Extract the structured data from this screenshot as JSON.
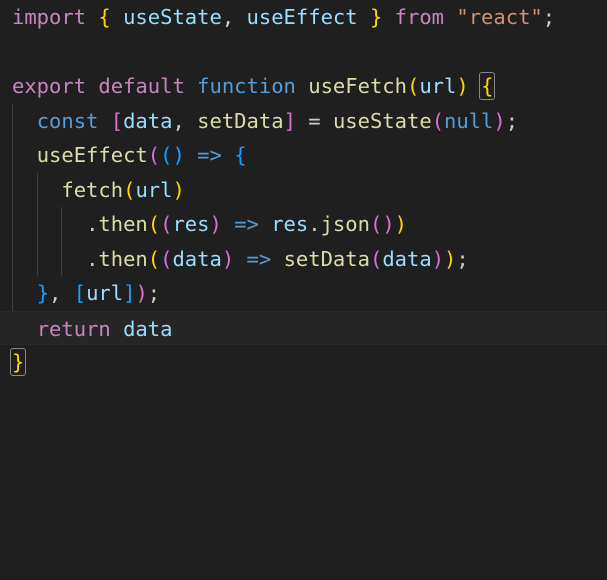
{
  "editor": {
    "name": "code-editor",
    "language": "javascript",
    "theme": "dark-plus",
    "background_color": "#1f1f1f",
    "current_line_color": "#262626",
    "indent_guide_color": "#404040",
    "bracket_match_outline_color": "#888888",
    "font_size_px": 20.5,
    "line_height_px": 34.5,
    "gutter_visible": false,
    "current_line_number": 10,
    "total_lines": 12
  },
  "colors": {
    "keyword": "#c586c0",
    "storage": "#569cd6",
    "variable": "#9cdcfe",
    "function": "#dcdcaa",
    "string": "#ce9178",
    "operator": "#569cd6",
    "punctuation": "#cccccc",
    "bracket_level_1": "#ffd700",
    "bracket_level_2": "#da70d6",
    "bracket_level_3": "#179fff",
    "plain_text": "#d4d4d4"
  },
  "code": {
    "plain_text": "import { useState, useEffect } from \"react\";\n\nexport default function useFetch(url) {\n  const [data, setData] = useState(null);\n  useEffect(() => {\n    fetch(url)\n      .then((res) => res.json())\n      .then((data) => setData(data));\n  }, [url]);\n  return data\n}",
    "lines": [
      {
        "number": 1,
        "indent": 0,
        "current": false,
        "tokens": [
          {
            "text": "import",
            "type": "keyword"
          },
          {
            "text": " ",
            "type": "plain"
          },
          {
            "text": "{",
            "type": "bracket1"
          },
          {
            "text": " ",
            "type": "plain"
          },
          {
            "text": "useState",
            "type": "variable"
          },
          {
            "text": ",",
            "type": "punct"
          },
          {
            "text": " ",
            "type": "plain"
          },
          {
            "text": "useEffect",
            "type": "variable"
          },
          {
            "text": " ",
            "type": "plain"
          },
          {
            "text": "}",
            "type": "bracket1"
          },
          {
            "text": " ",
            "type": "plain"
          },
          {
            "text": "from",
            "type": "keyword"
          },
          {
            "text": " ",
            "type": "plain"
          },
          {
            "text": "\"react\"",
            "type": "string"
          },
          {
            "text": ";",
            "type": "punct"
          }
        ]
      },
      {
        "number": 2,
        "indent": 0,
        "current": false,
        "tokens": []
      },
      {
        "number": 3,
        "indent": 0,
        "current": false,
        "tokens": [
          {
            "text": "export",
            "type": "keyword"
          },
          {
            "text": " ",
            "type": "plain"
          },
          {
            "text": "default",
            "type": "keyword"
          },
          {
            "text": " ",
            "type": "plain"
          },
          {
            "text": "function",
            "type": "storage"
          },
          {
            "text": " ",
            "type": "plain"
          },
          {
            "text": "useFetch",
            "type": "function"
          },
          {
            "text": "(",
            "type": "bracket1"
          },
          {
            "text": "url",
            "type": "variable"
          },
          {
            "text": ")",
            "type": "bracket1"
          },
          {
            "text": " ",
            "type": "plain"
          },
          {
            "text": "{",
            "type": "bracket1",
            "match": true
          }
        ]
      },
      {
        "number": 4,
        "indent": 1,
        "current": false,
        "tokens": [
          {
            "text": "  ",
            "type": "plain"
          },
          {
            "text": "const",
            "type": "storage"
          },
          {
            "text": " ",
            "type": "plain"
          },
          {
            "text": "[",
            "type": "bracket2"
          },
          {
            "text": "data",
            "type": "variable"
          },
          {
            "text": ",",
            "type": "punct"
          },
          {
            "text": " ",
            "type": "plain"
          },
          {
            "text": "setData",
            "type": "function"
          },
          {
            "text": "]",
            "type": "bracket2"
          },
          {
            "text": " ",
            "type": "plain"
          },
          {
            "text": "=",
            "type": "punct"
          },
          {
            "text": " ",
            "type": "plain"
          },
          {
            "text": "useState",
            "type": "function"
          },
          {
            "text": "(",
            "type": "bracket2"
          },
          {
            "text": "null",
            "type": "storage"
          },
          {
            "text": ")",
            "type": "bracket2"
          },
          {
            "text": ";",
            "type": "punct"
          }
        ]
      },
      {
        "number": 5,
        "indent": 1,
        "current": false,
        "tokens": [
          {
            "text": "  ",
            "type": "plain"
          },
          {
            "text": "useEffect",
            "type": "function"
          },
          {
            "text": "(",
            "type": "bracket2"
          },
          {
            "text": "(",
            "type": "bracket3"
          },
          {
            "text": ")",
            "type": "bracket3"
          },
          {
            "text": " ",
            "type": "plain"
          },
          {
            "text": "=>",
            "type": "operator"
          },
          {
            "text": " ",
            "type": "plain"
          },
          {
            "text": "{",
            "type": "bracket3"
          }
        ]
      },
      {
        "number": 6,
        "indent": 2,
        "current": false,
        "tokens": [
          {
            "text": "    ",
            "type": "plain"
          },
          {
            "text": "fetch",
            "type": "function"
          },
          {
            "text": "(",
            "type": "bracket1"
          },
          {
            "text": "url",
            "type": "variable"
          },
          {
            "text": ")",
            "type": "bracket1"
          }
        ]
      },
      {
        "number": 7,
        "indent": 3,
        "current": false,
        "tokens": [
          {
            "text": "      ",
            "type": "plain"
          },
          {
            "text": ".",
            "type": "punct"
          },
          {
            "text": "then",
            "type": "function"
          },
          {
            "text": "(",
            "type": "bracket1"
          },
          {
            "text": "(",
            "type": "bracket2"
          },
          {
            "text": "res",
            "type": "variable"
          },
          {
            "text": ")",
            "type": "bracket2"
          },
          {
            "text": " ",
            "type": "plain"
          },
          {
            "text": "=>",
            "type": "operator"
          },
          {
            "text": " ",
            "type": "plain"
          },
          {
            "text": "res",
            "type": "variable"
          },
          {
            "text": ".",
            "type": "punct"
          },
          {
            "text": "json",
            "type": "function"
          },
          {
            "text": "(",
            "type": "bracket2"
          },
          {
            "text": ")",
            "type": "bracket2"
          },
          {
            "text": ")",
            "type": "bracket1"
          }
        ]
      },
      {
        "number": 8,
        "indent": 3,
        "current": false,
        "tokens": [
          {
            "text": "      ",
            "type": "plain"
          },
          {
            "text": ".",
            "type": "punct"
          },
          {
            "text": "then",
            "type": "function"
          },
          {
            "text": "(",
            "type": "bracket1"
          },
          {
            "text": "(",
            "type": "bracket2"
          },
          {
            "text": "data",
            "type": "variable"
          },
          {
            "text": ")",
            "type": "bracket2"
          },
          {
            "text": " ",
            "type": "plain"
          },
          {
            "text": "=>",
            "type": "operator"
          },
          {
            "text": " ",
            "type": "plain"
          },
          {
            "text": "setData",
            "type": "function"
          },
          {
            "text": "(",
            "type": "bracket2"
          },
          {
            "text": "data",
            "type": "variable"
          },
          {
            "text": ")",
            "type": "bracket2"
          },
          {
            "text": ")",
            "type": "bracket1"
          },
          {
            "text": ";",
            "type": "punct"
          }
        ]
      },
      {
        "number": 9,
        "indent": 1,
        "current": false,
        "tokens": [
          {
            "text": "  ",
            "type": "plain"
          },
          {
            "text": "}",
            "type": "bracket3"
          },
          {
            "text": ",",
            "type": "punct"
          },
          {
            "text": " ",
            "type": "plain"
          },
          {
            "text": "[",
            "type": "bracket3"
          },
          {
            "text": "url",
            "type": "variable"
          },
          {
            "text": "]",
            "type": "bracket3"
          },
          {
            "text": ")",
            "type": "bracket2"
          },
          {
            "text": ";",
            "type": "punct"
          }
        ]
      },
      {
        "number": 10,
        "indent": 1,
        "current": true,
        "tokens": [
          {
            "text": "  ",
            "type": "plain"
          },
          {
            "text": "return",
            "type": "keyword"
          },
          {
            "text": " ",
            "type": "plain"
          },
          {
            "text": "data",
            "type": "variable"
          }
        ]
      },
      {
        "number": 11,
        "indent": 0,
        "current": false,
        "tokens": [
          {
            "text": "}",
            "type": "bracket1",
            "match": true
          }
        ]
      }
    ]
  }
}
